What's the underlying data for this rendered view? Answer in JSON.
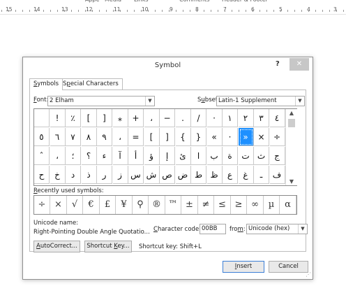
{
  "ruler": {
    "menu_items": [
      "Appe",
      "Media",
      "Links",
      "Comments",
      "Header & Footer"
    ],
    "numbers": [
      "15",
      "14",
      "13",
      "12",
      "11",
      "10",
      "9",
      "8",
      "7",
      "6",
      "5",
      "4",
      "3"
    ]
  },
  "dialog": {
    "title": "Symbol",
    "help": "?",
    "close": "✕",
    "tabs": [
      "Symbols",
      "Special Characters"
    ],
    "font_label": "Font:",
    "font_value": "2 Elham",
    "subset_label": "Subset:",
    "subset_value": "Latin-1 Supplement",
    "grid_rows": [
      [
        "",
        "!",
        "٪",
        "[",
        "]",
        "⁎",
        "+",
        "،",
        "−",
        ".",
        "/",
        "·",
        "١",
        "٢",
        "٣",
        "٤"
      ],
      [
        "٥",
        "٦",
        "٧",
        "٨",
        "٩",
        "،",
        "=",
        "[",
        "]",
        "{",
        "}",
        "«",
        "·",
        "»",
        "×",
        "÷"
      ],
      [
        "ˆ",
        "،",
        "؛",
        "؟",
        "ء",
        "آ",
        "أ",
        "ؤ",
        "إ",
        "ئ",
        "ا",
        "ب",
        "ة",
        "ت",
        "ث",
        "ج"
      ],
      [
        "ح",
        "خ",
        "د",
        "ذ",
        "ر",
        "ز",
        "س",
        "ش",
        "ص",
        "ض",
        "ط",
        "ظ",
        "ع",
        "غ",
        "ـ",
        "ف"
      ]
    ],
    "selected_cell": "»",
    "recent_label": "Recently used symbols:",
    "recent_symbols": [
      "÷",
      "×",
      "√",
      "€",
      "£",
      "¥",
      "⚲",
      "®",
      "™",
      "±",
      "≠",
      "≤",
      "≥",
      "∞",
      "µ",
      "α"
    ],
    "unicode_name_label": "Unicode name:",
    "unicode_name_value": "Right-Pointing Double Angle Quotatio...",
    "char_code_label": "Character code:",
    "char_code_value": "00BB",
    "from_label": "from:",
    "from_value": "Unicode (hex)",
    "autocorrect_button": "AutoCorrect...",
    "shortcut_key_button": "Shortcut Key...",
    "shortcut_key_text": "Shortcut key: Shift+L",
    "insert_button": "Insert",
    "cancel_button": "Cancel"
  },
  "colors": {
    "selected": "#1e90ff",
    "close_button": "#c7c7c7"
  }
}
